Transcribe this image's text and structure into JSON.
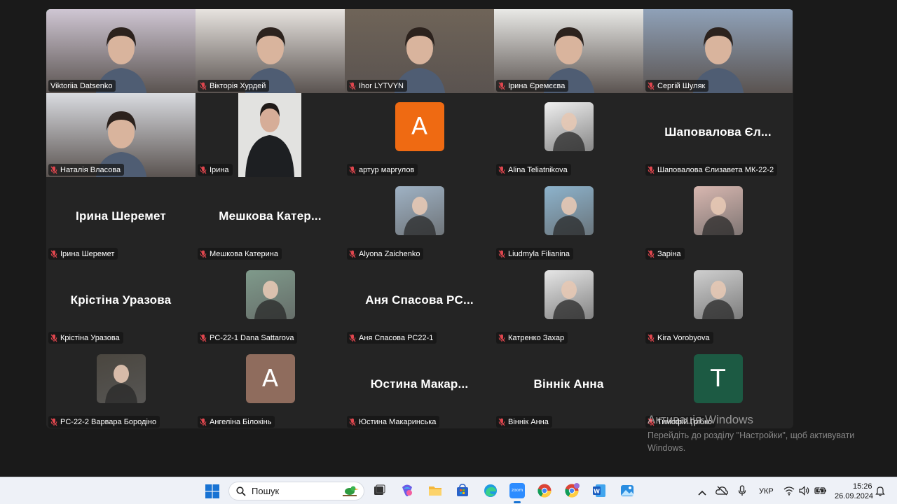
{
  "participants": [
    {
      "name": "Viktoriia Datsenko",
      "muted": false,
      "type": "video",
      "bg": "#cfc6d3",
      "active": true
    },
    {
      "name": "Вікторія Хурдей",
      "muted": true,
      "type": "video",
      "bg": "#e7e3df"
    },
    {
      "name": "Ihor LYTVYN",
      "muted": true,
      "type": "video",
      "bg": "#6f6458"
    },
    {
      "name": "Ірина Єремєєва",
      "muted": true,
      "type": "video",
      "bg": "#e9e9e6"
    },
    {
      "name": "Сергій Шуляк",
      "muted": true,
      "type": "video",
      "bg": "#8fa1b8"
    },
    {
      "name": "Наталія Власова",
      "muted": true,
      "type": "video",
      "bg": "#d9dbe0"
    },
    {
      "name": "Ірина",
      "muted": true,
      "type": "video-small",
      "bg": "#e2e2e0"
    },
    {
      "name": "артур маргулов",
      "muted": true,
      "type": "letter",
      "letter": "A",
      "color": "#ef6a12"
    },
    {
      "name": "Alina Teliatnikova",
      "muted": true,
      "type": "image",
      "bg": "#f0f0f0"
    },
    {
      "name": "Шаповалова Єлизавета МК-22-2",
      "muted": true,
      "type": "text",
      "display": "Шаповалова Єл..."
    },
    {
      "name": "Ірина Шеремет",
      "muted": true,
      "type": "text",
      "display": "Ірина Шеремет"
    },
    {
      "name": "Мешкова Катерина",
      "muted": true,
      "type": "text",
      "display": "Мешкова  Катер..."
    },
    {
      "name": "Alyona Zaichenko",
      "muted": true,
      "type": "image",
      "bg": "#9fb2c4"
    },
    {
      "name": "Liudmyla Filianina",
      "muted": true,
      "type": "image",
      "bg": "#8db3cc"
    },
    {
      "name": "Заріна",
      "muted": true,
      "type": "image",
      "bg": "#d8b7b0"
    },
    {
      "name": "Крістіна Уразова",
      "muted": true,
      "type": "text",
      "display": "Крістіна Уразова"
    },
    {
      "name": "PC-22-1 Dana Sattarova",
      "muted": true,
      "type": "image",
      "bg": "#7f9a8b"
    },
    {
      "name": "Аня Спасова PC22-1",
      "muted": true,
      "type": "text",
      "display": "Аня  Спасова  PC..."
    },
    {
      "name": "Катренко Захар",
      "muted": true,
      "type": "image",
      "bg": "#e6e6e6"
    },
    {
      "name": "Kira Vorobyova",
      "muted": true,
      "type": "image",
      "bg": "#cfcfcf"
    },
    {
      "name": "PC-22-2 Варвара Бородіно",
      "muted": true,
      "type": "image",
      "bg": "#4a463f"
    },
    {
      "name": "Ангеліна Білокінь",
      "muted": true,
      "type": "letter",
      "letter": "A",
      "color": "#8f6c5d"
    },
    {
      "name": "Юстина Макаринська",
      "muted": true,
      "type": "text",
      "display": "Юстина  Макар..."
    },
    {
      "name": "Віннік Анна",
      "muted": true,
      "type": "text",
      "display": "Віннік Анна"
    },
    {
      "name": "Тимофій Грiбко",
      "muted": true,
      "type": "letter",
      "letter": "T",
      "color": "#1c5a43"
    }
  ],
  "watermark": {
    "title": "Активація Windows",
    "subtitle": "Перейдіть до розділу \"Настройки\", щоб активувати Windows."
  },
  "taskbar": {
    "search_placeholder": "Пошук",
    "language": "УКР",
    "time": "15:26",
    "date": "26.09.2024"
  },
  "colors": {
    "active_border": "#3fd16b",
    "muted_red": "#e0464e",
    "grid_bg": "#242424"
  }
}
